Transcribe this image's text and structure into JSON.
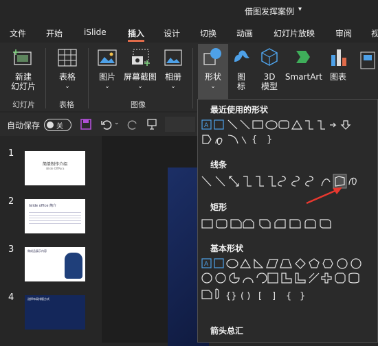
{
  "title_bar": {
    "document_title": "借图发挥案例",
    "caret": "▾"
  },
  "tabs": [
    "文件",
    "开始",
    "iSlide",
    "插入",
    "设计",
    "切换",
    "动画",
    "幻灯片放映",
    "审阅",
    "视"
  ],
  "ribbon": {
    "new_slide": "新建\n幻灯片",
    "table": "表格",
    "picture": "图片",
    "screenshot": "屏幕截图",
    "album": "相册",
    "shapes": "形状",
    "icons": "图\n标",
    "model3d": "3D\n模型",
    "smartart": "SmartArt",
    "chart": "图表",
    "groups": {
      "slides": "幻灯片",
      "tables": "表格",
      "images": "图像"
    }
  },
  "qat": {
    "autosave_label": "自动保存",
    "toggle_state": "关"
  },
  "slides": [
    {
      "num": "1",
      "title": "简单制作介绍",
      "subtitle": "iSlide OffPara"
    },
    {
      "num": "2",
      "title": "Islide office 简介"
    },
    {
      "num": "3",
      "title": "做成品展示内容"
    },
    {
      "num": "4",
      "title": "选择布局排版方式"
    }
  ],
  "shapes_menu": {
    "recent": "最近使用的形状",
    "lines": "线条",
    "rectangles": "矩形",
    "basic": "基本形状",
    "arrows": "箭头总汇"
  },
  "colors": {
    "accent": "#e06b4a",
    "highlight": "#4ea1e8",
    "arrow": "#e8382f"
  }
}
